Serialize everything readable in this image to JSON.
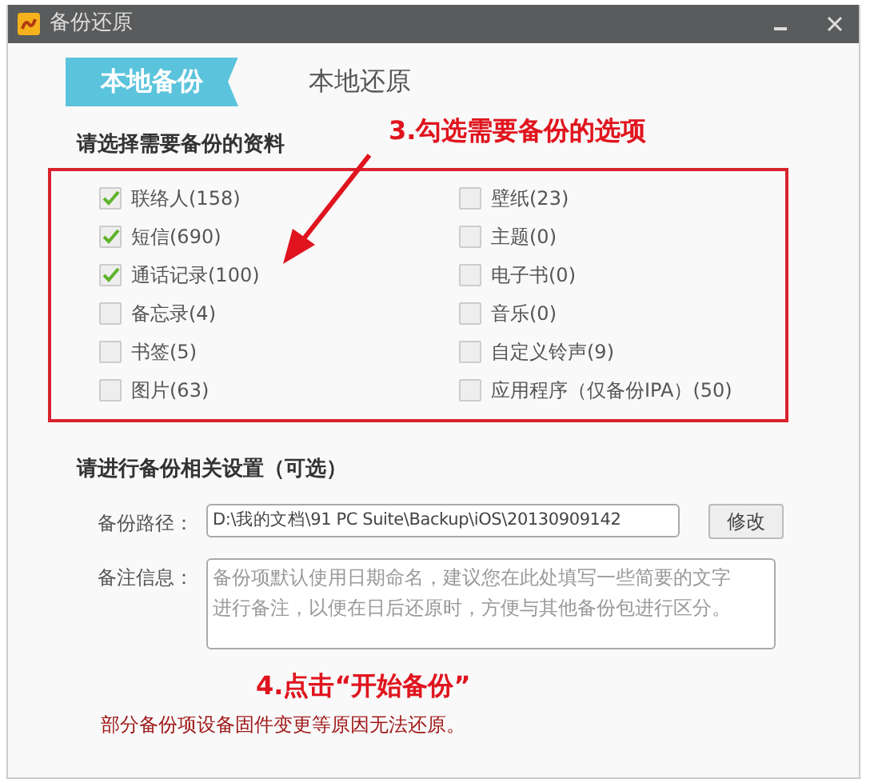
{
  "window": {
    "title": "备份还原",
    "controls": [
      {
        "kind": "minimize"
      },
      {
        "kind": "close"
      }
    ]
  },
  "tabs": [
    {
      "label": "本地备份",
      "selected": true
    },
    {
      "label": "本地还原",
      "selected": false
    }
  ],
  "data_section": {
    "heading": "请选择需要备份的资料",
    "items": [
      {
        "label": "联络人(158)",
        "checked": true
      },
      {
        "label": "壁纸(23)",
        "checked": false
      },
      {
        "label": "短信(690)",
        "checked": true
      },
      {
        "label": "主题(0)",
        "checked": false
      },
      {
        "label": "通话记录(100)",
        "checked": true
      },
      {
        "label": "电子书(0)",
        "checked": false
      },
      {
        "label": "备忘录(4)",
        "checked": false
      },
      {
        "label": "音乐(0)",
        "checked": false
      },
      {
        "label": "书签(5)",
        "checked": false
      },
      {
        "label": "自定义铃声(9)",
        "checked": false
      },
      {
        "label": "图片(63)",
        "checked": false
      },
      {
        "label": "应用程序（仅备份IPA）(50)",
        "checked": false
      }
    ]
  },
  "settings_section": {
    "heading": "请进行备份相关设置（可选）",
    "path": {
      "label": "备份路径：",
      "value": "D:\\我的文档\\91 PC Suite\\Backup\\iOS\\20130909142",
      "button": "修改"
    },
    "notes": {
      "label": "备注信息：",
      "placeholder": "备份项默认使用日期命名，建议您在此处填写一些简要的文字进行备注，以便在日后还原时，方便与其他备份包进行区分。"
    }
  },
  "footer_note": "部分备份项设备固件变更等原因无法还原。",
  "annotations": [
    {
      "text": "3.勾选需要备份的选项"
    },
    {
      "text": "4.点击“开始备份”"
    }
  ]
}
